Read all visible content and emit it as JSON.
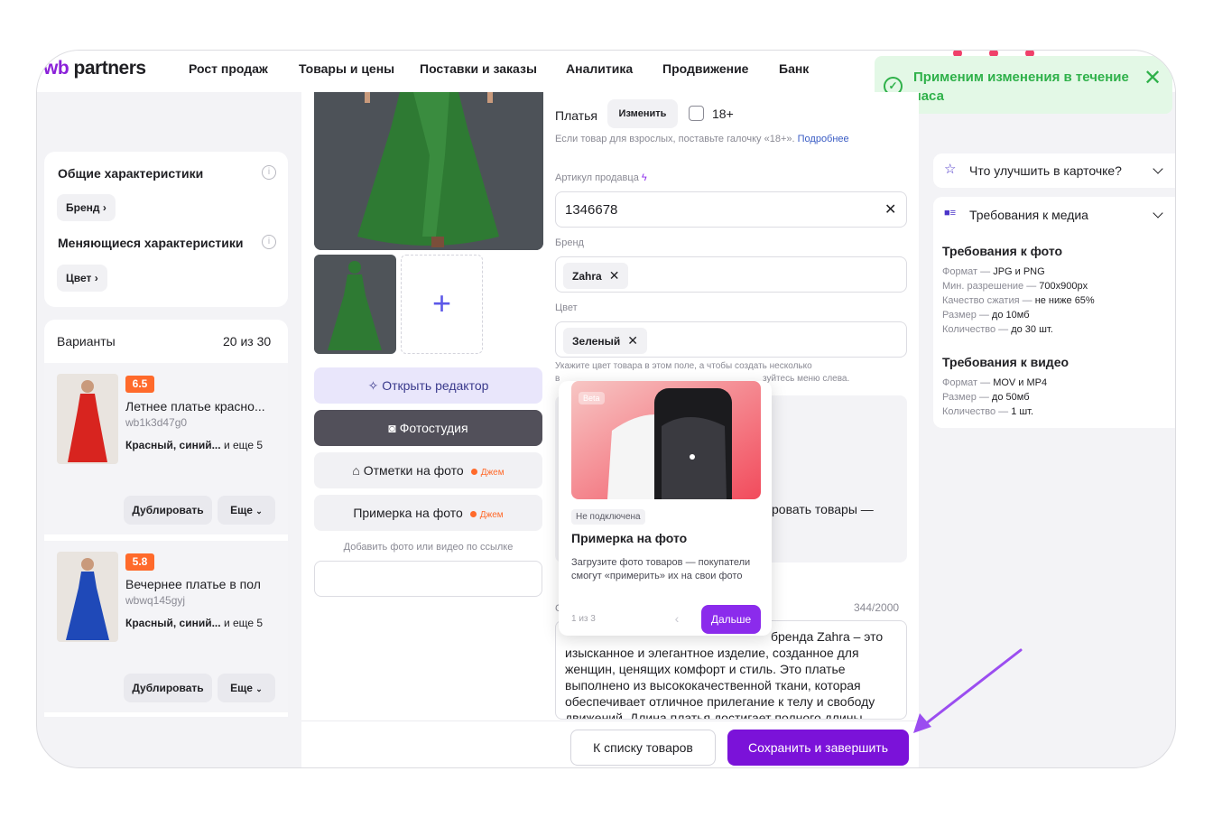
{
  "nav": {
    "logo_wb": "wb",
    "logo_partners": "partners",
    "items": [
      "Рост продаж",
      "Товары и цены",
      "Поставки и заказы",
      "Аналитика",
      "Продвижение",
      "Банк"
    ]
  },
  "toast": {
    "text": "Применим изменения в течение часа",
    "close": "✕"
  },
  "sidebar": {
    "general_title": "Общие характеристики",
    "brand_chip": "Бренд",
    "changing_title": "Меняющиеся характеристики",
    "color_chip": "Цвет",
    "variants_label": "Варианты",
    "variants_count": "20 из 30",
    "variants": [
      {
        "rating": "6.5",
        "title": "Летнее платье красно...",
        "sku": "wb1k3d47g0",
        "colors": "Красный, синий...",
        "colors_more": " и еще 5",
        "duplicate": "Дублировать",
        "more": "Еще",
        "dress_color": "#d8241f"
      },
      {
        "rating": "5.8",
        "title": "Вечернее платье в пол",
        "sku": "wbwq145gyj",
        "colors": "Красный, синий...",
        "colors_more": " и еще 5",
        "duplicate": "Дублировать",
        "more": "Еще",
        "dress_color": "#1f49b8"
      }
    ]
  },
  "media": {
    "add_icon": "+",
    "btn_editor": "Открыть редактор",
    "btn_studio": "Фотостудия",
    "btn_marks": "Отметки на фото",
    "btn_tryon": "Примерка на фото",
    "jem": "Джем",
    "add_by_link": "Добавить фото или видео по ссылке"
  },
  "form": {
    "category": "Платья",
    "change_btn": "Изменить",
    "adult_label": "18+",
    "adult_hint": "Если товар для взрослых, поставьте галочку «18+».",
    "adult_more": "Подробнее",
    "sku_label": "Артикул продавца",
    "sku_value": "1346678",
    "brand_label": "Бренд",
    "brand_value": "Zahra",
    "color_label": "Цвет",
    "color_value": "Зеленый",
    "color_hint_1": "Укажите цвет товара в этом поле, а чтобы создать несколько",
    "color_hint_2_prefix": "в",
    "color_hint_2": "зуйтесь меню слева.",
    "desc_fragment": "ровать товары —",
    "desc_label_initial": "С",
    "desc_counter": "344/2000",
    "description_first": "бренда Zahra – это",
    "description_lines": [
      "изысканное и элегантное изделие, созданное для",
      "женщин, ценящих комфорт и стиль. Это платье",
      "выполнено из высококачественной ткани, которая",
      "обеспечивает отличное прилегание к телу и свободу",
      "движений. Длина платья достигает полного длины"
    ]
  },
  "popup": {
    "beta": "Beta",
    "badge": "Не подключена",
    "title": "Примерка на фото",
    "text": "Загрузите фото товаров — покупатели смогут «примерить» их на свои фото",
    "count": "1 из 3",
    "prev": "‹",
    "next": "Дальше"
  },
  "bottom": {
    "back": "К списку товаров",
    "save": "Сохранить и завершить"
  },
  "right": {
    "improve": "Что улучшить в карточке?",
    "media_req": "Требования к медиа",
    "photo_title": "Требования к фото",
    "photo_lines": [
      {
        "k": "Формат — ",
        "v": "JPG и PNG"
      },
      {
        "k": "Мин. разрешение — ",
        "v": "700x900px"
      },
      {
        "k": "Качество сжатия — ",
        "v": "не ниже 65%"
      },
      {
        "k": "Размер — ",
        "v": "до 10мб"
      },
      {
        "k": "Количество — ",
        "v": "до 30 шт."
      }
    ],
    "video_title": "Требования к видео",
    "video_lines": [
      {
        "k": "Формат — ",
        "v": "MOV и MP4"
      },
      {
        "k": "Размер — ",
        "v": "до 50мб"
      },
      {
        "k": "Количество — ",
        "v": "1 шт."
      }
    ]
  },
  "colors": {
    "accent": "#7b12d9",
    "success": "#2fb14a",
    "rating": "#ff6a2b",
    "arrow": "#9b4df0"
  }
}
